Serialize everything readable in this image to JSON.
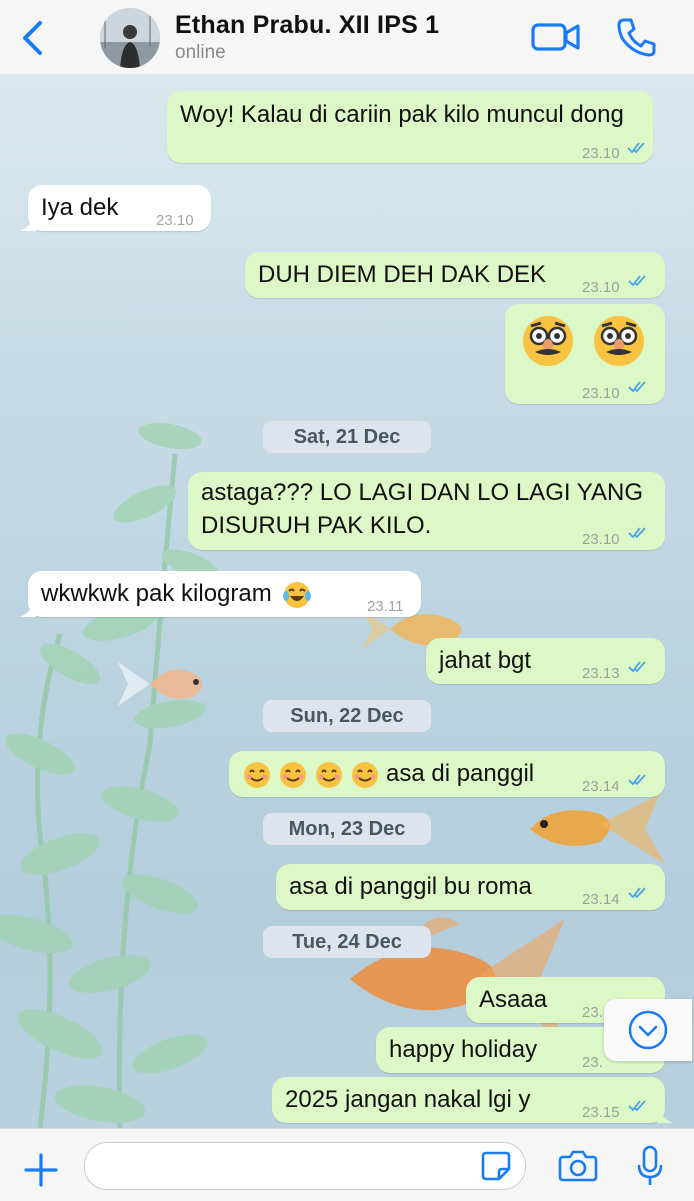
{
  "header": {
    "contact_name": "Ethan Prabu. XII IPS 1",
    "status": "online"
  },
  "messages": [
    {
      "dir": "out",
      "text": "Woy! Kalau di cariin pak kilo muncul dong",
      "time": "23.10",
      "read": true
    },
    {
      "dir": "in",
      "text": "Iya dek",
      "time": "23.10"
    },
    {
      "dir": "out",
      "text": "DUH DIEM DEH DAK DEK",
      "time": "23.10",
      "read": true
    },
    {
      "dir": "out",
      "text": "",
      "emoji": [
        "disguised-face",
        "disguised-face"
      ],
      "time": "23.10",
      "read": true
    },
    {
      "date": "Sat, 21 Dec"
    },
    {
      "dir": "out",
      "text_line1": "astaga??? LO LAGI DAN LO LAGI YANG",
      "text_line2": "DISURUH PAK KILO.",
      "time": "23.10",
      "read": true
    },
    {
      "dir": "in",
      "text": "wkwkwk pak kilogram",
      "emoji": [
        "tears-of-joy"
      ],
      "time": "23.11"
    },
    {
      "dir": "out",
      "text": "jahat bgt",
      "time": "23.13",
      "read": true
    },
    {
      "date": "Sun, 22 Dec"
    },
    {
      "dir": "out",
      "text": "asa di panggil",
      "emoji": [
        "smiling-face",
        "smiling-face",
        "smiling-face",
        "smiling-face"
      ],
      "time": "23.14",
      "read": true
    },
    {
      "date": "Mon, 23 Dec"
    },
    {
      "dir": "out",
      "text": "asa di panggil bu roma",
      "time": "23.14",
      "read": true
    },
    {
      "date": "Tue, 24 Dec"
    },
    {
      "dir": "out",
      "text": "Asaaa",
      "time": "23.",
      "read": true
    },
    {
      "dir": "out",
      "text": "happy holiday",
      "time": "23.",
      "read": true
    },
    {
      "dir": "out",
      "text": "2025 jangan nakal lgi y",
      "time": "23.15",
      "read": true
    }
  ],
  "colors": {
    "outgoing_bubble": "#dcf8c6",
    "incoming_bubble": "#ffffff",
    "accent": "#1a7cf5",
    "read_ticks": "#4aa3e8"
  },
  "icons": {
    "back": "chevron-left-icon",
    "video": "video-camera-icon",
    "call": "phone-icon",
    "scroll": "chevron-down-circle-icon",
    "add": "plus-icon",
    "sticker": "sticker-icon",
    "camera": "camera-icon",
    "mic": "microphone-icon"
  }
}
